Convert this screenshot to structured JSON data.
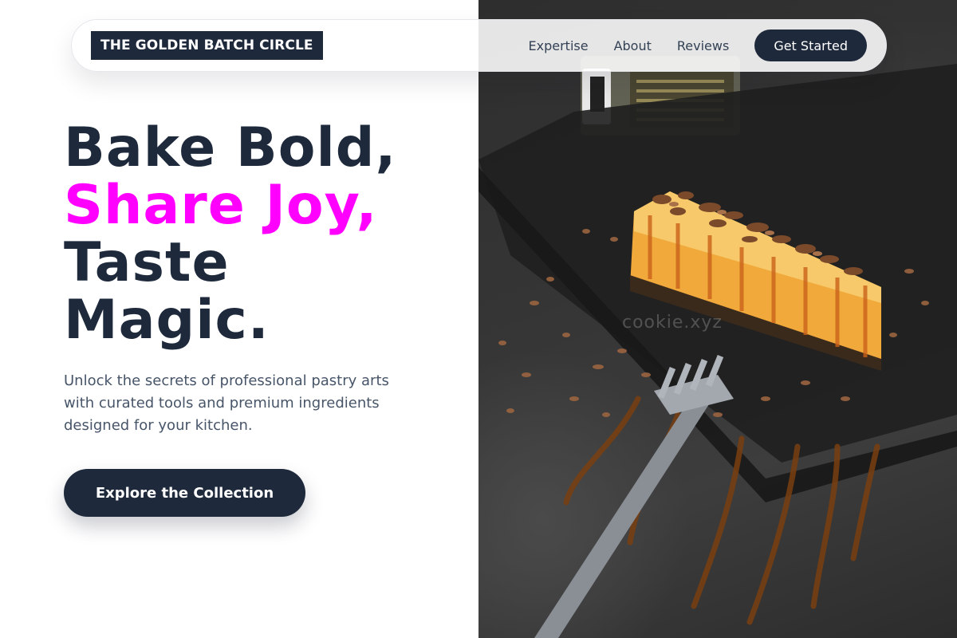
{
  "brand": {
    "name": "THE GOLDEN BATCH CIRCLE"
  },
  "nav": {
    "links": [
      "Expertise",
      "About",
      "Reviews"
    ],
    "cta": "Get Started"
  },
  "hero": {
    "title_line1": "Bake Bold,",
    "title_line2": "Share Joy,",
    "title_line3": "Taste",
    "title_line4": "Magic.",
    "subtitle": "Unlock the secrets of professional pastry arts with curated tools and premium ingredients designed for your kitchen.",
    "button": "Explore the Collection"
  },
  "image": {
    "subject": "cheesecake slice with chocolate shavings and caramel drizzle on dark slate with a fork",
    "watermark": "cookie.xyz"
  },
  "colors": {
    "primary": "#1e293b",
    "accent": "#ff00ff",
    "text_muted": "#475569",
    "background": "#ffffff"
  }
}
